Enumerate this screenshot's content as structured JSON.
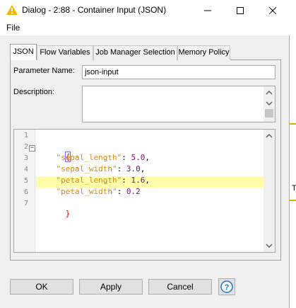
{
  "window": {
    "title": "Dialog - 2:88 - Container Input (JSON)"
  },
  "menu": {
    "file": "File"
  },
  "tabs": [
    {
      "label": "JSON",
      "active": true
    },
    {
      "label": "Flow Variables",
      "active": false
    },
    {
      "label": "Job Manager Selection",
      "active": false
    },
    {
      "label": "Memory Policy",
      "active": false
    }
  ],
  "form": {
    "param_label": "Parameter Name:",
    "param_value": "json-input",
    "desc_label": "Description:",
    "desc_value": ""
  },
  "editor": {
    "line_numbers": [
      "1",
      "2",
      "3",
      "4",
      "5",
      "6",
      "7"
    ],
    "lines": [
      {
        "key": "\"sepal_length\"",
        "value": "5.0",
        "sep": ",",
        "line": "3"
      },
      {
        "key": "\"sepal_width\"",
        "value": "3.0",
        "sep": ",",
        "line": "4"
      },
      {
        "key": "\"petal_length\"",
        "value": "1.6",
        "sep": ",",
        "line": "5"
      },
      {
        "key": "\"petal_width\"",
        "value": "0.2",
        "sep": "",
        "line": "6"
      }
    ],
    "open_brace": "{",
    "close_brace": "}",
    "colon": ": "
  },
  "buttons": {
    "ok": "OK",
    "apply": "Apply",
    "cancel": "Cancel",
    "help": "?"
  },
  "colors": {
    "key": "#d4891c",
    "number": "#7a0e7a",
    "brace": "#d00000",
    "active_line": "#ffffaa",
    "help_accent": "#1e72c8"
  }
}
